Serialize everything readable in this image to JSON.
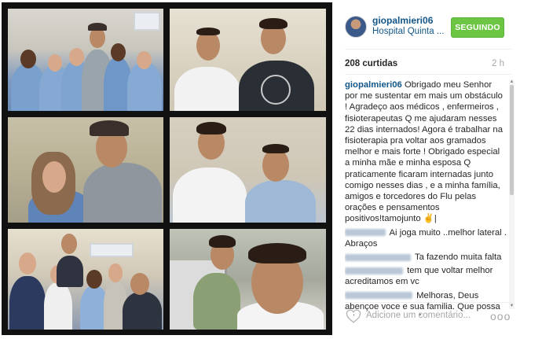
{
  "post": {
    "photos": [
      {
        "desc": "group"
      },
      {
        "desc": "two-men"
      },
      {
        "desc": "woman-man-cap"
      },
      {
        "desc": "two-men-hospital"
      },
      {
        "desc": "group-hospital"
      },
      {
        "desc": "selfie-bed"
      }
    ]
  },
  "header": {
    "username": "giopalmieri06",
    "location": "Hospital Quinta ...",
    "follow_label": "SEGUINDO",
    "follow_color": "#6cc644"
  },
  "stats": {
    "likes": "208 curtidas",
    "time": "2 h"
  },
  "caption": {
    "user": "giopalmieri06",
    "text": "Obrigado meu Senhor por me sustentar em mais um obstáculo ! Agradeço aos médicos , enfermeiros , fisioterapeutas Q me ajudaram nesses 22 dias internados! Agora é trabalhar na fisioterapia pra voltar aos gramados melhor e mais forte ! Obrigado especial a minha mãe e minha esposa Q praticamente ficaram internadas junto comigo nesses dias , e a minha família, amigos e torcedores do Flu pelas orações e pensamentos positivos!tamojunto ✌️|"
  },
  "comments": [
    {
      "text": "Ai joga muito ..melhor lateral . Abraços"
    },
    {
      "text": "Ta fazendo muita falta"
    },
    {
      "text": "tem que voltar melhor acreditamos em vc"
    },
    {
      "text": "Melhoras, Deus abençoe voce e sua familia. Que possa retorna em campo logo"
    }
  ],
  "footer": {
    "comment_placeholder": "Adicione um comentário...",
    "more_label": "ooo"
  },
  "icons": {
    "heart": "heart-icon",
    "more": "more-options-icon"
  }
}
